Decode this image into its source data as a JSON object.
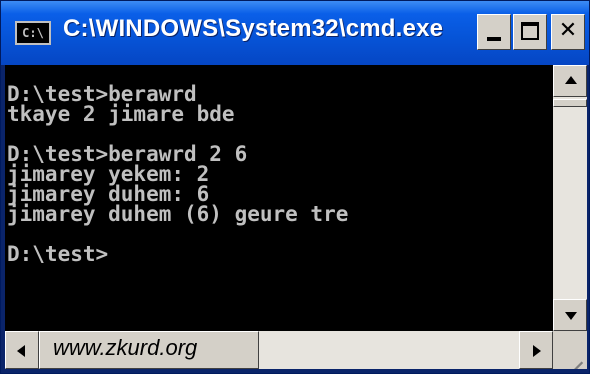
{
  "window": {
    "title": "C:\\WINDOWS\\System32\\cmd.exe",
    "icon_label": "C:\\",
    "colors": {
      "titlebar": "#0653d6",
      "console_bg": "#000000",
      "console_text": "#c0c0c0",
      "chrome": "#d4d0c8"
    }
  },
  "titlebar_buttons": {
    "minimize_icon": "minimize-icon",
    "maximize_icon": "maximize-icon",
    "close_icon": "close-icon",
    "close_glyph": "✕"
  },
  "console": {
    "lines": [
      "D:\\test>berawrd",
      "tkaye 2 jimare bde",
      "",
      "D:\\test>berawrd 2 6",
      "jimarey yekem: 2",
      "jimarey duhem: 6",
      "jimarey duhem (6) geure tre",
      "",
      "D:\\test>"
    ]
  },
  "statusbar": {
    "watermark": "www.zkurd.org"
  }
}
